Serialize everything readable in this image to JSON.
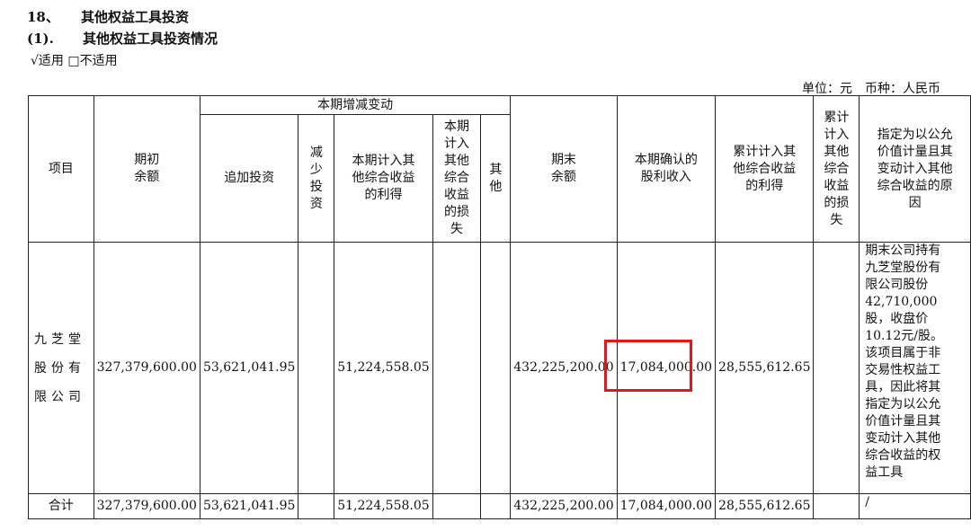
{
  "section": {
    "number": "18、",
    "title": "其他权益工具投资"
  },
  "subsection": {
    "number": "(1).",
    "title": "其他权益工具投资情况"
  },
  "applicability": {
    "checked": "√适用",
    "unchecked": "□不适用"
  },
  "unit_line": "单位：元　币种：人民币",
  "table": {
    "headers": {
      "item": "项目",
      "opening": "期初\n余额",
      "change_group": "本期增减变动",
      "add": "追加投资",
      "reduce": "减\n少\n投\n资",
      "gain": "本期计入其\n他综合收益\n的利得",
      "loss": "本期\n计入\n其他\n综合\n收益\n的损\n失",
      "other": "其\n他",
      "closing": "期末\n余额",
      "dividend": "本期确认的\n股利收入",
      "cum_gain": "累计计入其\n他综合收益\n的利得",
      "cum_loss": "累计\n计入\n其他\n综合\n收益\n的损\n失",
      "reason": "指定为以公允\n价值计量且其\n变动计入其他\n综合收益的原\n因"
    },
    "rows": [
      {
        "item": "九芝堂\n股份有\n限公司",
        "opening": "327,379,600.00",
        "add": "53,621,041.95",
        "reduce": "",
        "gain": "51,224,558.05",
        "loss": "",
        "other": "",
        "closing": "432,225,200.00",
        "dividend": "17,084,000.00",
        "cum_gain": "28,555,612.65",
        "cum_loss": "",
        "reason": "期末公司持有\n九芝堂股份有\n限公司股份\n42,710,000\n股，收盘价\n10.12元/股。\n该项目属于非\n交易性权益工\n具，因此将其\n指定为以公允\n价值计量且其\n变动计入其他\n综合收益的权\n益工具"
      },
      {
        "item": "合计",
        "opening": "327,379,600.00",
        "add": "53,621,041.95",
        "reduce": "",
        "gain": "51,224,558.05",
        "loss": "",
        "other": "",
        "closing": "432,225,200.00",
        "dividend": "17,084,000.00",
        "cum_gain": "28,555,612.65",
        "cum_loss": "",
        "reason": "/"
      }
    ]
  },
  "highlight_color": "#e0191f"
}
